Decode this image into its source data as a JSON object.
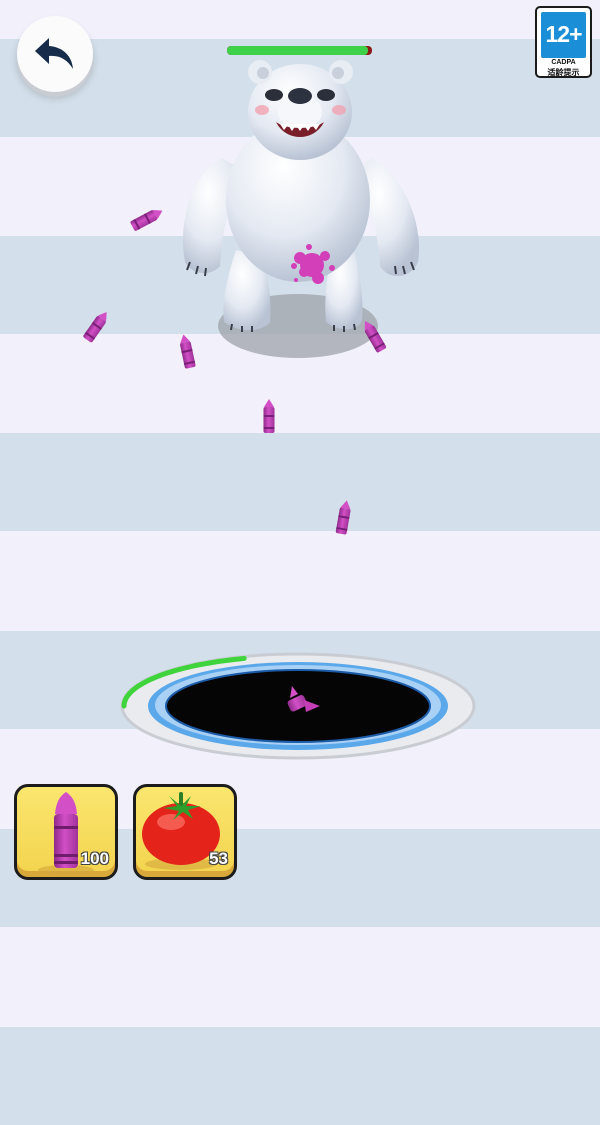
{
  "game": {
    "enemy": {
      "name": "polar-bear",
      "health_fraction": 0.97
    },
    "age_rating": {
      "label": "12+",
      "org": "CADPA",
      "note": "适龄提示"
    },
    "hole_charge_fraction": 0.4,
    "weapons": [
      {
        "name": "crayon",
        "count": "100"
      },
      {
        "name": "tomato",
        "count": "53"
      }
    ]
  },
  "colors": {
    "stripe_light": "#f1f0fb",
    "stripe_blue": "#d3dfea",
    "crayon": "#c43fb7",
    "health": "#3ed24a",
    "charge": "#3fd33c",
    "portal_ring": "#5aa8ea",
    "slot_bg": "#f4d955"
  }
}
